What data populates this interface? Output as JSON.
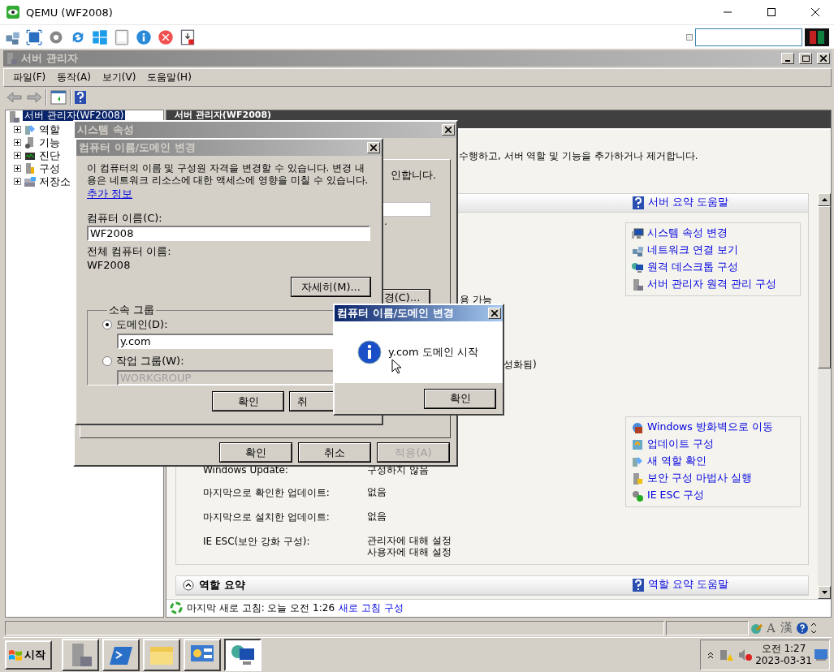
{
  "window": {
    "title": "QEMU (WF2008)"
  },
  "qemu_toolbar": {
    "buttons": [
      {
        "kind": "network"
      },
      {
        "kind": "fullscreen"
      },
      {
        "kind": "settings"
      },
      {
        "kind": "refresh"
      },
      {
        "kind": "windows"
      },
      {
        "kind": "keyboard"
      },
      {
        "kind": "info"
      },
      {
        "kind": "stop"
      },
      {
        "kind": "screenshot"
      }
    ]
  },
  "server_manager": {
    "title": "서버 관리자",
    "menu": [
      "파일(F)",
      "동작(A)",
      "보기(V)",
      "도움말(H)"
    ],
    "tree": {
      "label": "서버 관리자(WF2008)",
      "selected": true,
      "children": [
        {
          "label": "역할",
          "kind": "roles",
          "expanded": false
        },
        {
          "label": "기능",
          "kind": "features",
          "expanded": false
        },
        {
          "label": "진단",
          "kind": "diagnostics",
          "expanded": false
        },
        {
          "label": "구성",
          "kind": "configuration",
          "expanded": false
        },
        {
          "label": "저장소",
          "kind": "storage",
          "expanded": false
        }
      ]
    },
    "pane": {
      "header": "서버 관리자(WF2008)",
      "description": "수행하고, 서버 역할 및 기능을 추가하거나 제거합니다.",
      "summary": {
        "help_link": "서버 요약 도움말",
        "rows": [
          {
            "kind": "fragment",
            "values": [
              "용 가능"
            ]
          },
          {
            "kind": "fragment",
            "values": [
              "성화됨)"
            ]
          },
          {
            "kind": "setting",
            "label": "Windows Update:",
            "values": [
              "구성하지 않음"
            ]
          },
          {
            "kind": "setting",
            "label": "마지막으로 확인한 업데이트:",
            "values": [
              "없음"
            ]
          },
          {
            "kind": "setting",
            "label": "마지막으로 설치한 업데이트:",
            "values": [
              "없음"
            ]
          },
          {
            "kind": "setting",
            "label": "IE ESC(보안 강화 구성):",
            "values": [
              "관리자에 대해 설정",
              "사용자에 대해 설정"
            ]
          }
        ],
        "task_groups": [
          [
            {
              "label": "시스템 속성 변경",
              "kind": "system"
            },
            {
              "label": "네트워크 연결 보기",
              "kind": "network"
            },
            {
              "label": "원격 데스크톱 구성",
              "kind": "remote"
            },
            {
              "label": "서버 관리자 원격 관리 구성",
              "kind": "server"
            }
          ],
          [
            {
              "label": "Windows 방화벽으로 이동",
              "kind": "firewall"
            },
            {
              "label": "업데이트 구성",
              "kind": "update"
            },
            {
              "label": "새 역할 확인",
              "kind": "roles"
            },
            {
              "label": "보안 구성 마법사 실행",
              "kind": "security"
            },
            {
              "label": "IE ESC 구성",
              "kind": "iesc"
            }
          ]
        ]
      },
      "roles": {
        "title": "역할 요약",
        "help_link": "역할 요약 도움말"
      },
      "refresh": {
        "text": "마지막 새로 고침: 오늘 오전 1:26",
        "link": "새로 고침 구성"
      }
    },
    "status_bar": {
      "ime": [
        "A",
        "漢"
      ]
    }
  },
  "system_properties": {
    "title": "시스템 속성",
    "panel_text": "인합니다.",
    "panel_note": ".",
    "change_button": "경(C)...",
    "buttons": [
      {
        "label": "확인",
        "disabled": false
      },
      {
        "label": "취소",
        "disabled": false
      },
      {
        "label": "적용(A)",
        "disabled": true
      }
    ]
  },
  "name_dialog": {
    "title": "컴퓨터 이름/도메인 변경",
    "intro": [
      "이 컴퓨터의 이름 및 구성원 자격을 변경할 수 있습니다. 변경 내",
      "용은 네트워크 리소스에 대한 액세스에 영향을 미칠 수 있습니다."
    ],
    "more_link": "추가 정보",
    "name_label": "컴퓨터 이름(C):",
    "name_value": "WF2008",
    "full_label": "전체 컴퓨터 이름:",
    "full_value": "WF2008",
    "more_button": "자세히(M)...",
    "group": {
      "title": "소속 그룹",
      "options": [
        {
          "label": "도메인(D):",
          "selected": true,
          "value": "y.com",
          "disabled": false
        },
        {
          "label": "작업 그룹(W):",
          "selected": false,
          "value": "WORKGROUP",
          "disabled": true
        }
      ]
    },
    "buttons": [
      "확인",
      "취"
    ]
  },
  "message": {
    "title": "컴퓨터 이름/도메인 변경",
    "text": "y.com 도메인 시작",
    "button": "확인"
  },
  "taskbar": {
    "start": "시작",
    "tasks": [
      {
        "kind": "server",
        "selected": false
      },
      {
        "kind": "powershell",
        "selected": false
      },
      {
        "kind": "explorer",
        "selected": false
      },
      {
        "kind": "control",
        "selected": false
      },
      {
        "kind": "remote",
        "selected": true
      }
    ],
    "clock": {
      "time": "오전 1:27",
      "date": "2023-03-31"
    }
  }
}
